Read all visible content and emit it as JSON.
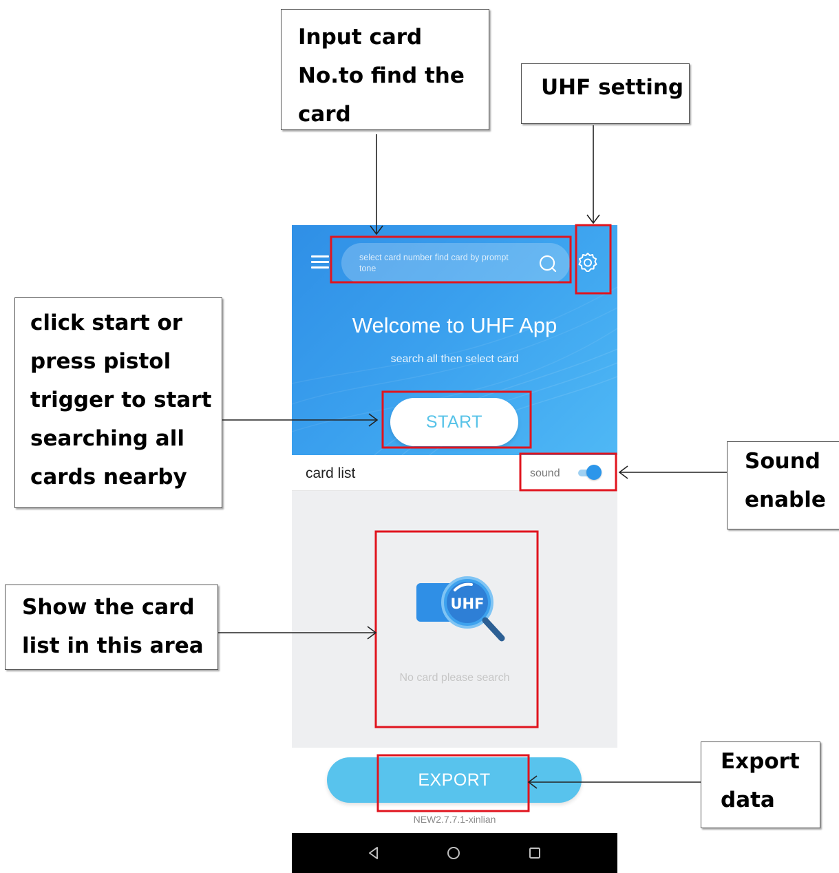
{
  "annotations": {
    "input_card": "Input card\nNo.to find the\ncard",
    "uhf_setting": "UHF setting",
    "start_search": "click start or\npress pistol\ntrigger to start\nsearching  all\ncards nearby",
    "sound_enable": "Sound\nenable",
    "card_list_area": "Show the card\nlist in this area",
    "export_data": "Export\ndata"
  },
  "app": {
    "header": {
      "search_placeholder": "select card number find card by prompt tone",
      "welcome_title": "Welcome to UHF App",
      "welcome_subtitle": "search all then select card",
      "start_label": "START"
    },
    "list_bar": {
      "title": "card list",
      "sound_label": "sound",
      "sound_enabled": true
    },
    "empty_state": {
      "badge": "UHF",
      "message": "No card please search"
    },
    "footer": {
      "export_label": "EXPORT",
      "version": "NEW2.7.7.1-xinlian"
    }
  },
  "icons": {
    "menu": "menu-icon",
    "search": "search-icon",
    "settings": "gear-icon",
    "nav_back": "back-triangle-icon",
    "nav_home": "home-circle-icon",
    "nav_recent": "recent-square-icon"
  },
  "colors": {
    "header_blue": "#3aa0ee",
    "accent_blue": "#58c3ed",
    "toggle_blue": "#2c96ea",
    "highlight_red": "#e0141e"
  }
}
